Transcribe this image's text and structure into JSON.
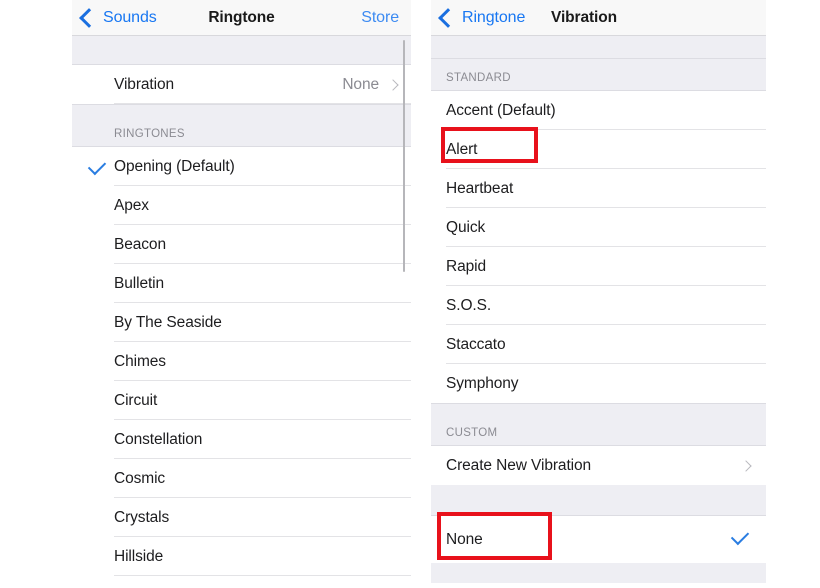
{
  "ringtone_panel": {
    "navbar": {
      "back_label": "Sounds",
      "title": "Ringtone",
      "right_label": "Store"
    },
    "vibration_row": {
      "label": "Vibration",
      "value": "None"
    },
    "section_header": "RINGTONES",
    "ringtones": [
      {
        "label": "Opening (Default)",
        "selected": true
      },
      {
        "label": "Apex",
        "selected": false
      },
      {
        "label": "Beacon",
        "selected": false
      },
      {
        "label": "Bulletin",
        "selected": false
      },
      {
        "label": "By The Seaside",
        "selected": false
      },
      {
        "label": "Chimes",
        "selected": false
      },
      {
        "label": "Circuit",
        "selected": false
      },
      {
        "label": "Constellation",
        "selected": false
      },
      {
        "label": "Cosmic",
        "selected": false
      },
      {
        "label": "Crystals",
        "selected": false
      },
      {
        "label": "Hillside",
        "selected": false
      }
    ]
  },
  "vibration_panel": {
    "navbar": {
      "back_label": "Ringtone",
      "title": "Vibration"
    },
    "standard_header": "STANDARD",
    "standard": [
      {
        "label": "Accent (Default)",
        "selected": false
      },
      {
        "label": "Alert",
        "selected": false
      },
      {
        "label": "Heartbeat",
        "selected": false
      },
      {
        "label": "Quick",
        "selected": false
      },
      {
        "label": "Rapid",
        "selected": false
      },
      {
        "label": "S.O.S.",
        "selected": false
      },
      {
        "label": "Staccato",
        "selected": false
      },
      {
        "label": "Symphony",
        "selected": false
      }
    ],
    "custom_header": "CUSTOM",
    "custom": [
      {
        "label": "Create New Vibration",
        "chevron": true
      }
    ],
    "none_row": {
      "label": "None",
      "selected": true
    }
  },
  "annotations": {
    "highlight_color": "#e8111b",
    "boxes": [
      {
        "target": "Alert"
      },
      {
        "target": "None"
      }
    ]
  },
  "colors": {
    "accent_blue": "#1877f2",
    "check_blue": "#2a7de1",
    "section_bg": "#eeeef3",
    "separator": "#e3e3e6"
  }
}
